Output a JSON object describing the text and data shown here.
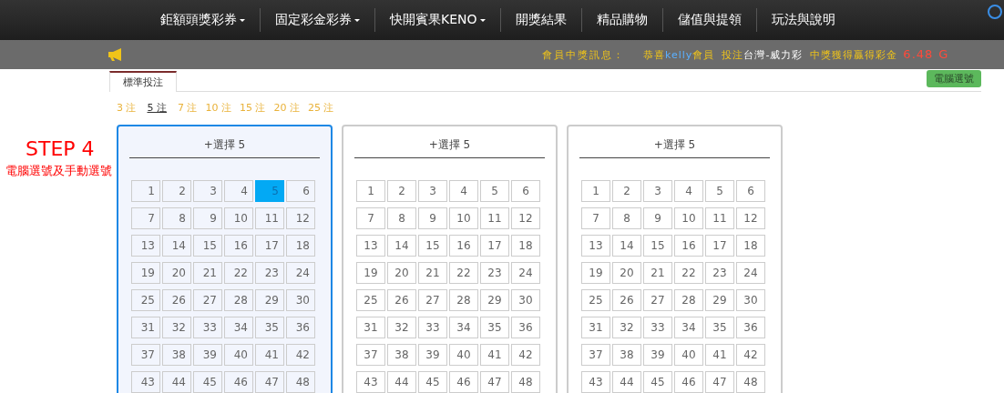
{
  "nav": {
    "items": [
      {
        "label": "鉅額頭獎彩券",
        "dropdown": true
      },
      {
        "label": "固定彩金彩券",
        "dropdown": true
      },
      {
        "label": "快開賓果KENO",
        "dropdown": true
      },
      {
        "label": "開獎結果",
        "dropdown": false
      },
      {
        "label": "精品購物",
        "dropdown": false
      },
      {
        "label": "儲值與提領",
        "dropdown": false
      },
      {
        "label": "玩法與說明",
        "dropdown": false
      }
    ]
  },
  "ticker": {
    "label": "會員中獎訊息：",
    "parts": [
      {
        "text": "恭喜",
        "kind": "yellow"
      },
      {
        "text": "kelly",
        "kind": "blue"
      },
      {
        "text": "會員",
        "kind": "yellow"
      },
      {
        "text": "投注",
        "kind": "yellow"
      },
      {
        "text": "台灣-威力彩",
        "kind": "white"
      },
      {
        "text": "中獎獲得贏得彩金",
        "kind": "yellow"
      },
      {
        "text": "6.48",
        "kind": "red"
      },
      {
        "text": "G",
        "kind": "red"
      }
    ]
  },
  "tabs": [
    {
      "label": "標準投注",
      "selected": true
    }
  ],
  "auto_pick_button": "電腦選號",
  "bet_counts": [
    {
      "label": "3 注",
      "selected": false
    },
    {
      "label": "5 注",
      "selected": true
    },
    {
      "label": "7 注",
      "selected": false
    },
    {
      "label": "10 注",
      "selected": false
    },
    {
      "label": "15 注",
      "selected": false
    },
    {
      "label": "20 注",
      "selected": false
    },
    {
      "label": "25 注",
      "selected": false
    }
  ],
  "annotation": {
    "step": "STEP 4",
    "text": "電腦選號及手動選號"
  },
  "cards": [
    {
      "title": "+選擇 5",
      "selected": true,
      "numbers": [
        {
          "label": "1",
          "selected": false
        },
        {
          "label": "2",
          "selected": false
        },
        {
          "label": "3",
          "selected": false
        },
        {
          "label": "4",
          "selected": false
        },
        {
          "label": "5",
          "selected": true
        },
        {
          "label": "6",
          "selected": false
        },
        {
          "label": "7",
          "selected": false
        },
        {
          "label": "8",
          "selected": false
        },
        {
          "label": "9",
          "selected": false
        },
        {
          "label": "10",
          "selected": false
        },
        {
          "label": "11",
          "selected": false
        },
        {
          "label": "12",
          "selected": false
        },
        {
          "label": "13",
          "selected": false
        },
        {
          "label": "14",
          "selected": false
        },
        {
          "label": "15",
          "selected": false
        },
        {
          "label": "16",
          "selected": false
        },
        {
          "label": "17",
          "selected": false
        },
        {
          "label": "18",
          "selected": false
        },
        {
          "label": "19",
          "selected": false
        },
        {
          "label": "20",
          "selected": false
        },
        {
          "label": "21",
          "selected": false
        },
        {
          "label": "22",
          "selected": false
        },
        {
          "label": "23",
          "selected": false
        },
        {
          "label": "24",
          "selected": false
        },
        {
          "label": "25",
          "selected": false
        },
        {
          "label": "26",
          "selected": false
        },
        {
          "label": "27",
          "selected": false
        },
        {
          "label": "28",
          "selected": false
        },
        {
          "label": "29",
          "selected": false
        },
        {
          "label": "30",
          "selected": false
        },
        {
          "label": "31",
          "selected": false
        },
        {
          "label": "32",
          "selected": false
        },
        {
          "label": "33",
          "selected": false
        },
        {
          "label": "34",
          "selected": false
        },
        {
          "label": "35",
          "selected": false
        },
        {
          "label": "36",
          "selected": false
        },
        {
          "label": "37",
          "selected": false
        },
        {
          "label": "38",
          "selected": false
        },
        {
          "label": "39",
          "selected": false
        },
        {
          "label": "40",
          "selected": false
        },
        {
          "label": "41",
          "selected": false
        },
        {
          "label": "42",
          "selected": false
        },
        {
          "label": "43",
          "selected": false
        },
        {
          "label": "44",
          "selected": false
        },
        {
          "label": "45",
          "selected": false
        },
        {
          "label": "46",
          "selected": false
        },
        {
          "label": "47",
          "selected": false
        },
        {
          "label": "48",
          "selected": false
        }
      ]
    },
    {
      "title": "+選擇 5",
      "selected": false,
      "numbers": [
        {
          "label": "1",
          "selected": false
        },
        {
          "label": "2",
          "selected": false
        },
        {
          "label": "3",
          "selected": false
        },
        {
          "label": "4",
          "selected": false
        },
        {
          "label": "5",
          "selected": false
        },
        {
          "label": "6",
          "selected": false
        },
        {
          "label": "7",
          "selected": false
        },
        {
          "label": "8",
          "selected": false
        },
        {
          "label": "9",
          "selected": false
        },
        {
          "label": "10",
          "selected": false
        },
        {
          "label": "11",
          "selected": false
        },
        {
          "label": "12",
          "selected": false
        },
        {
          "label": "13",
          "selected": false
        },
        {
          "label": "14",
          "selected": false
        },
        {
          "label": "15",
          "selected": false
        },
        {
          "label": "16",
          "selected": false
        },
        {
          "label": "17",
          "selected": false
        },
        {
          "label": "18",
          "selected": false
        },
        {
          "label": "19",
          "selected": false
        },
        {
          "label": "20",
          "selected": false
        },
        {
          "label": "21",
          "selected": false
        },
        {
          "label": "22",
          "selected": false
        },
        {
          "label": "23",
          "selected": false
        },
        {
          "label": "24",
          "selected": false
        },
        {
          "label": "25",
          "selected": false
        },
        {
          "label": "26",
          "selected": false
        },
        {
          "label": "27",
          "selected": false
        },
        {
          "label": "28",
          "selected": false
        },
        {
          "label": "29",
          "selected": false
        },
        {
          "label": "30",
          "selected": false
        },
        {
          "label": "31",
          "selected": false
        },
        {
          "label": "32",
          "selected": false
        },
        {
          "label": "33",
          "selected": false
        },
        {
          "label": "34",
          "selected": false
        },
        {
          "label": "35",
          "selected": false
        },
        {
          "label": "36",
          "selected": false
        },
        {
          "label": "37",
          "selected": false
        },
        {
          "label": "38",
          "selected": false
        },
        {
          "label": "39",
          "selected": false
        },
        {
          "label": "40",
          "selected": false
        },
        {
          "label": "41",
          "selected": false
        },
        {
          "label": "42",
          "selected": false
        },
        {
          "label": "43",
          "selected": false
        },
        {
          "label": "44",
          "selected": false
        },
        {
          "label": "45",
          "selected": false
        },
        {
          "label": "46",
          "selected": false
        },
        {
          "label": "47",
          "selected": false
        },
        {
          "label": "48",
          "selected": false
        }
      ]
    },
    {
      "title": "+選擇 5",
      "selected": false,
      "numbers": [
        {
          "label": "1",
          "selected": false
        },
        {
          "label": "2",
          "selected": false
        },
        {
          "label": "3",
          "selected": false
        },
        {
          "label": "4",
          "selected": false
        },
        {
          "label": "5",
          "selected": false
        },
        {
          "label": "6",
          "selected": false
        },
        {
          "label": "7",
          "selected": false
        },
        {
          "label": "8",
          "selected": false
        },
        {
          "label": "9",
          "selected": false
        },
        {
          "label": "10",
          "selected": false
        },
        {
          "label": "11",
          "selected": false
        },
        {
          "label": "12",
          "selected": false
        },
        {
          "label": "13",
          "selected": false
        },
        {
          "label": "14",
          "selected": false
        },
        {
          "label": "15",
          "selected": false
        },
        {
          "label": "16",
          "selected": false
        },
        {
          "label": "17",
          "selected": false
        },
        {
          "label": "18",
          "selected": false
        },
        {
          "label": "19",
          "selected": false
        },
        {
          "label": "20",
          "selected": false
        },
        {
          "label": "21",
          "selected": false
        },
        {
          "label": "22",
          "selected": false
        },
        {
          "label": "23",
          "selected": false
        },
        {
          "label": "24",
          "selected": false
        },
        {
          "label": "25",
          "selected": false
        },
        {
          "label": "26",
          "selected": false
        },
        {
          "label": "27",
          "selected": false
        },
        {
          "label": "28",
          "selected": false
        },
        {
          "label": "29",
          "selected": false
        },
        {
          "label": "30",
          "selected": false
        },
        {
          "label": "31",
          "selected": false
        },
        {
          "label": "32",
          "selected": false
        },
        {
          "label": "33",
          "selected": false
        },
        {
          "label": "34",
          "selected": false
        },
        {
          "label": "35",
          "selected": false
        },
        {
          "label": "36",
          "selected": false
        },
        {
          "label": "37",
          "selected": false
        },
        {
          "label": "38",
          "selected": false
        },
        {
          "label": "39",
          "selected": false
        },
        {
          "label": "40",
          "selected": false
        },
        {
          "label": "41",
          "selected": false
        },
        {
          "label": "42",
          "selected": false
        },
        {
          "label": "43",
          "selected": false
        },
        {
          "label": "44",
          "selected": false
        },
        {
          "label": "45",
          "selected": false
        },
        {
          "label": "46",
          "selected": false
        },
        {
          "label": "47",
          "selected": false
        },
        {
          "label": "48",
          "selected": false
        }
      ]
    }
  ]
}
